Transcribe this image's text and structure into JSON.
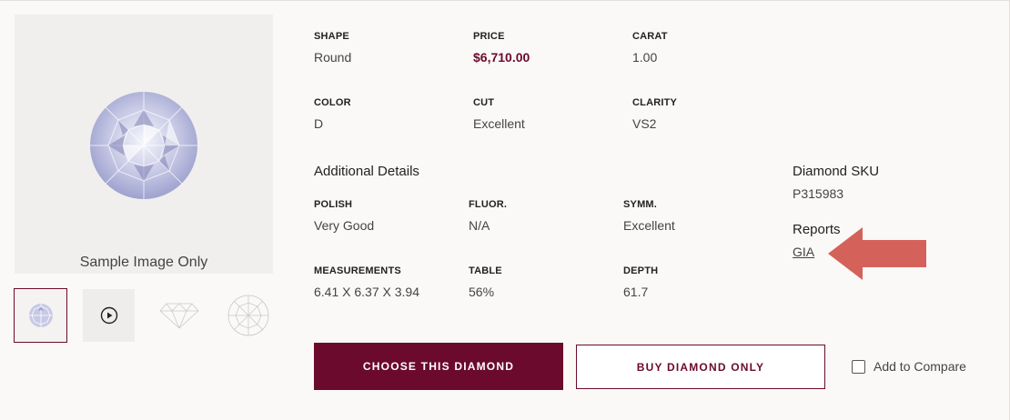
{
  "image": {
    "caption": "Sample Image Only",
    "thumbnails": [
      "diamond-photo-icon",
      "play-video-icon",
      "diamond-profile-icon",
      "diamond-top-view-icon"
    ]
  },
  "specs": {
    "shape": {
      "label": "SHAPE",
      "value": "Round"
    },
    "price": {
      "label": "PRICE",
      "value": "$6,710.00"
    },
    "carat": {
      "label": "CARAT",
      "value": "1.00"
    },
    "color": {
      "label": "COLOR",
      "value": "D"
    },
    "cut": {
      "label": "CUT",
      "value": "Excellent"
    },
    "clarity": {
      "label": "CLARITY",
      "value": "VS2"
    }
  },
  "additional": {
    "title": "Additional Details",
    "polish": {
      "label": "POLISH",
      "value": "Very Good"
    },
    "fluor": {
      "label": "FLUOR.",
      "value": "N/A"
    },
    "symm": {
      "label": "SYMM.",
      "value": "Excellent"
    },
    "measurements": {
      "label": "MEASUREMENTS",
      "value": "6.41 X 6.37 X 3.94"
    },
    "table": {
      "label": "TABLE",
      "value": "56%"
    },
    "depth": {
      "label": "DEPTH",
      "value": "61.7"
    }
  },
  "sku": {
    "label": "Diamond SKU",
    "value": "P315983"
  },
  "reports": {
    "label": "Reports",
    "link": "GIA"
  },
  "actions": {
    "choose": "CHOOSE THIS DIAMOND",
    "buy": "BUY DIAMOND ONLY",
    "compare": "Add to Compare"
  },
  "colors": {
    "brand": "#6b0a2d",
    "arrow": "#d4625a",
    "background": "#faf9f8"
  }
}
